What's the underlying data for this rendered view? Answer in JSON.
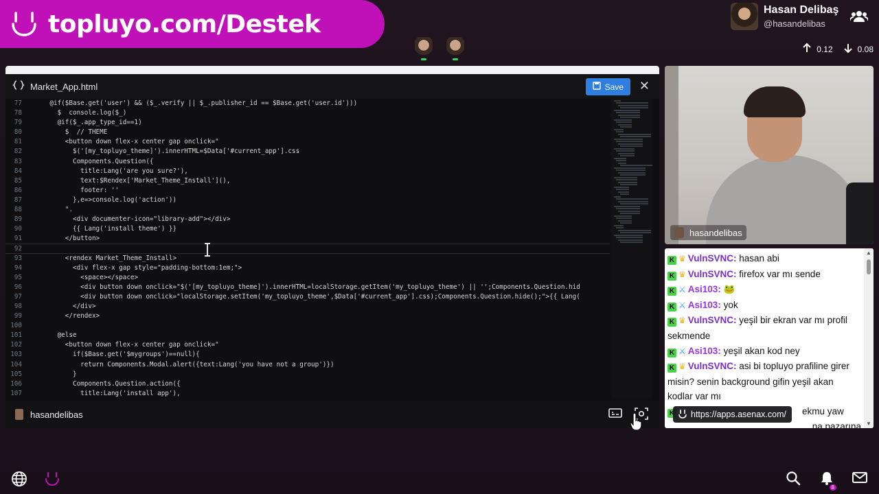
{
  "banner": {
    "text": "topluyo.com/Destek"
  },
  "profile": {
    "name": "Hasan Delibaş",
    "handle": "@hasandelibas"
  },
  "stats": {
    "up": "0.12",
    "down": "0.08"
  },
  "editor": {
    "filename": "Market_App.html",
    "save_label": "Save",
    "footer_user": "hasandelibas",
    "lines": [
      {
        "n": "77",
        "t": "    @if($Base.get('user') && ($_.verify || $_.publisher_id == $Base.get('user.id')))"
      },
      {
        "n": "78",
        "t": "      $  console.log($_)"
      },
      {
        "n": "79",
        "t": "      @if($_.app_type_id==1)"
      },
      {
        "n": "80",
        "t": "        $  // THEME"
      },
      {
        "n": "81",
        "t": "        <button down flex-x center gap onclick=\""
      },
      {
        "n": "82",
        "t": "          $('[my_topluyo_theme]').innerHTML=$Data['#current_app'].css"
      },
      {
        "n": "83",
        "t": "          Components.Question({"
      },
      {
        "n": "84",
        "t": "            title:Lang('are you sure?'),"
      },
      {
        "n": "85",
        "t": "            text:$Rendex['Market_Theme_Install'](),"
      },
      {
        "n": "86",
        "t": "            footer: ''"
      },
      {
        "n": "87",
        "t": "          },e=>console.log('action'))"
      },
      {
        "n": "88",
        "t": "        \"."
      },
      {
        "n": "89",
        "t": "          <div documenter-icon=\"library-add\"></div>"
      },
      {
        "n": "90",
        "t": "          {{ Lang('install theme') }}"
      },
      {
        "n": "91",
        "t": "        </button>"
      },
      {
        "n": "92",
        "t": ""
      },
      {
        "n": "93",
        "t": "        <rendex Market_Theme_Install>"
      },
      {
        "n": "94",
        "t": "          <div flex-x gap style=\"padding-bottom:1em;\">"
      },
      {
        "n": "95",
        "t": "            <space></space>"
      },
      {
        "n": "96",
        "t": "            <div button down onclick=\"$('[my_topluyo_theme]').innerHTML=localStorage.getItem('my_topluyo_theme') || '';Components.Question.hid"
      },
      {
        "n": "97",
        "t": "            <div button down onclick=\"localStorage.setItem('my_topluyo_theme',$Data['#current_app'].css);Components.Question.hide();\">{{ Lang("
      },
      {
        "n": "98",
        "t": "          </div>"
      },
      {
        "n": "99",
        "t": "        </rendex>"
      },
      {
        "n": "100",
        "t": ""
      },
      {
        "n": "101",
        "t": "      @else"
      },
      {
        "n": "102",
        "t": "        <button down flex-x center gap onclick=\""
      },
      {
        "n": "103",
        "t": "          if($Base.get('$mygroups')==null){"
      },
      {
        "n": "104",
        "t": "            return Components.Modal.alert({text:Lang('you have not a group')})"
      },
      {
        "n": "105",
        "t": "          }"
      },
      {
        "n": "106",
        "t": "          Components.Question.action({"
      },
      {
        "n": "107",
        "t": "            title:Lang('install app'),"
      }
    ]
  },
  "webcam": {
    "name": "hasandelibas"
  },
  "chat": {
    "messages": [
      {
        "user": "VulnSVNC",
        "badge": "crown",
        "text": "hasan abi"
      },
      {
        "user": "VulnSVNC",
        "badge": "crown",
        "text": "firefox var mı sende"
      },
      {
        "user": "Asi103",
        "badge": "sword",
        "text": "🐸"
      },
      {
        "user": "Asi103",
        "badge": "sword",
        "text": "yok"
      },
      {
        "user": "VulnSVNC",
        "badge": "crown",
        "text": "yeşil bir ekran var mı profil sekmende"
      },
      {
        "user": "Asi103",
        "badge": "sword",
        "text": "yeşil akan kod ney"
      },
      {
        "user": "VulnSVNC",
        "badge": "crown",
        "text": "asi bi topluyo prafiline girer misin? senin background gifin yeşil akan kodlar var mı"
      }
    ],
    "partial_1": "ekmu yaw",
    "partial_2": "na pazarına"
  },
  "url_tooltip": "https://apps.asenax.com/",
  "notif_count": "8",
  "colors": {
    "brand": "#c010b8",
    "save": "#2f7fe0",
    "chat_user": "#7a2fc6",
    "mod_badge": "#49d14a"
  }
}
